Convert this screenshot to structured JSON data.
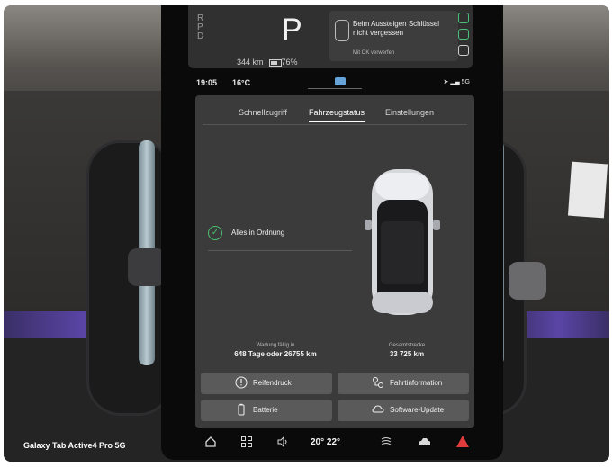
{
  "drive": {
    "gear_letters": [
      "R",
      "P",
      "D"
    ],
    "current_gear": "P",
    "range": "344 km",
    "battery": "76%"
  },
  "notification": {
    "title": "Beim Aussteigen Schlüssel nicht vergessen",
    "hint": "Mit OK verwerfen"
  },
  "status_bar": {
    "time": "19:05",
    "outside_temp": "16°C",
    "network": "5G"
  },
  "tabs": [
    {
      "label": "Schnellzugriff",
      "active": false
    },
    {
      "label": "Fahrzeugstatus",
      "active": true
    },
    {
      "label": "Einstellungen",
      "active": false
    }
  ],
  "vehicle_status": {
    "ok_text": "Alles in Ordnung",
    "service_label": "Wartung fällig in",
    "service_value": "648 Tage oder 26755 km",
    "odometer_label": "Gesamtstrecke",
    "odometer_value": "33 725 km"
  },
  "buttons": {
    "tire_pressure": "Reifendruck",
    "trip_info": "Fahrtinformation",
    "battery": "Batterie",
    "software_update": "Software-Update"
  },
  "climate": {
    "display": "20° 22°"
  },
  "icons": [
    "home-icon",
    "apps-icon",
    "volume-icon",
    "seat-heat-left-icon",
    "seat-heat-right-icon",
    "climate-icon",
    "car-icon",
    "hazard-icon"
  ],
  "colors": {
    "accent_ok": "#4cbf6c",
    "hazard": "#e23b3b",
    "panel_bg": "#3b3b3c",
    "button_bg": "#5a5a5b"
  },
  "watermark": "Galaxy Tab Active4 Pro 5G"
}
